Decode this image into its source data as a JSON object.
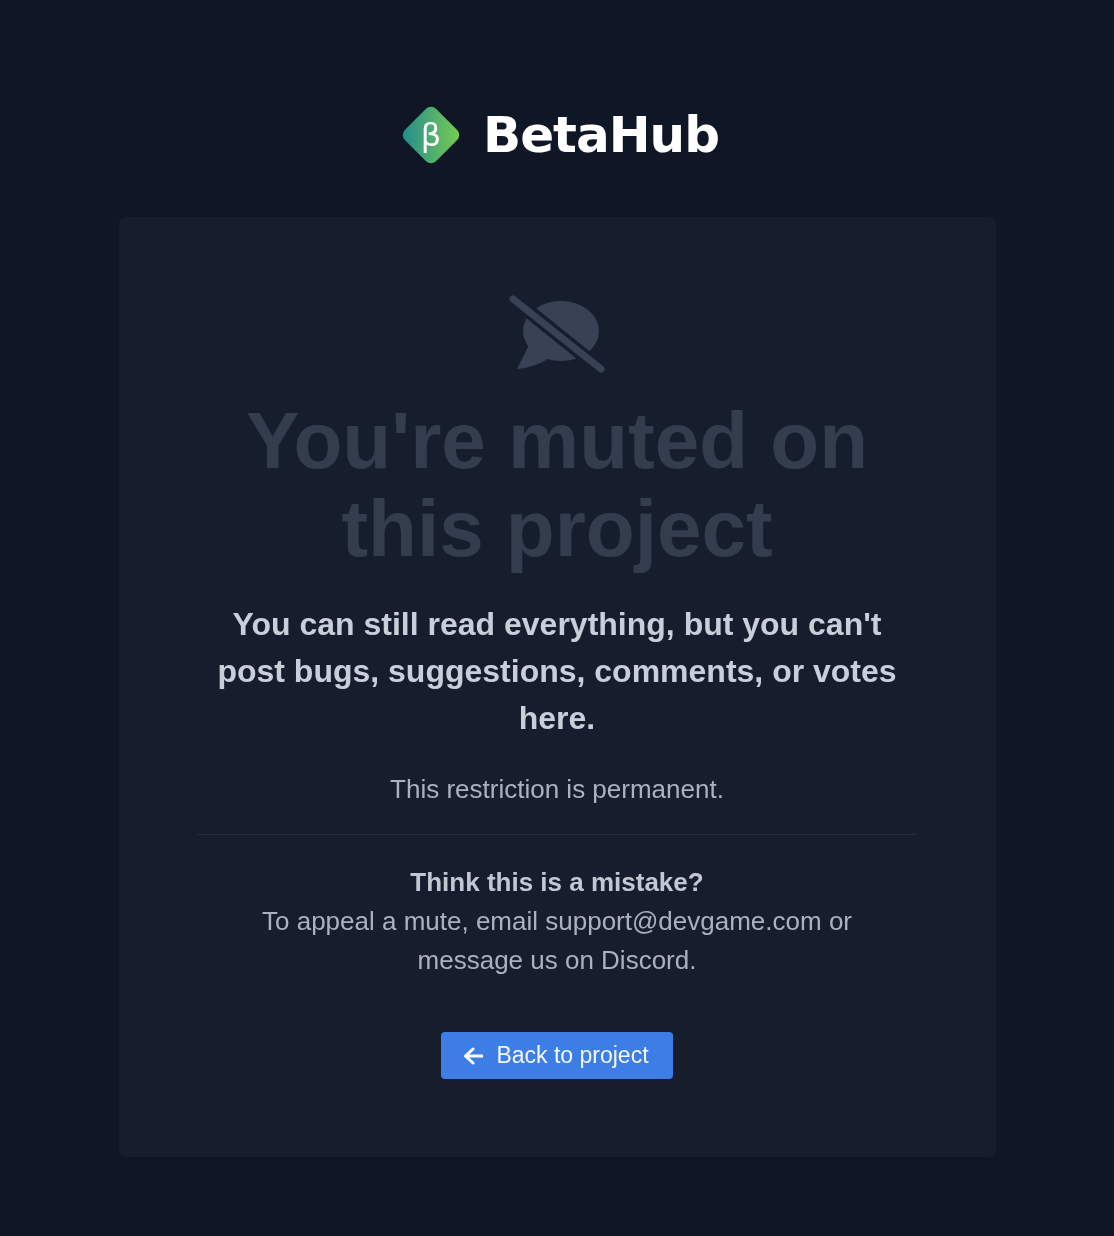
{
  "logo": {
    "mark": "β",
    "name": "BetaHub"
  },
  "notice": {
    "title": "You're muted on this project",
    "message": "You can still read everything, but you can't post bugs, suggestions, comments, or votes here.",
    "status": "This restriction is permanent."
  },
  "appeal": {
    "heading": "Think this is a mistake?",
    "text": "To appeal a mute, email support@devgame.com or message us on Discord."
  },
  "button": {
    "label": "Back to project"
  }
}
